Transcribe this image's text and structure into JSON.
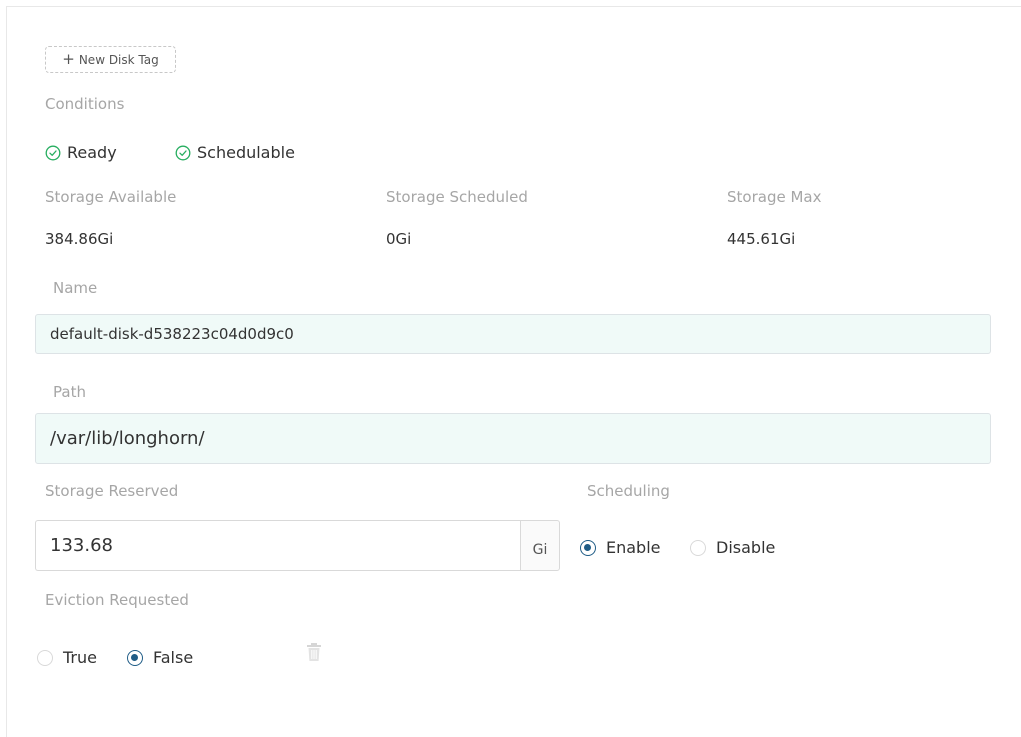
{
  "new_tag_button": {
    "label": "New Disk Tag",
    "icon": "plus-icon"
  },
  "conditions": {
    "label": "Conditions",
    "items": [
      {
        "label": "Ready",
        "icon": "check-circle-icon"
      },
      {
        "label": "Schedulable",
        "icon": "check-circle-icon"
      }
    ],
    "ok_color": "#27ae60"
  },
  "storage": {
    "available": {
      "label": "Storage Available",
      "value": "384.86Gi"
    },
    "scheduled": {
      "label": "Storage Scheduled",
      "value": "0Gi"
    },
    "max": {
      "label": "Storage Max",
      "value": "445.61Gi"
    }
  },
  "name_field": {
    "label": "Name",
    "value": "default-disk-d538223c04d0d9c0"
  },
  "path_field": {
    "label": "Path",
    "value": "/var/lib/longhorn/"
  },
  "storage_reserved": {
    "label": "Storage Reserved",
    "value": "133.68",
    "unit": "Gi"
  },
  "scheduling": {
    "label": "Scheduling",
    "options": [
      {
        "label": "Enable",
        "selected": true
      },
      {
        "label": "Disable",
        "selected": false
      }
    ]
  },
  "eviction": {
    "label": "Eviction Requested",
    "options": [
      {
        "label": "True",
        "selected": false
      },
      {
        "label": "False",
        "selected": true
      }
    ]
  },
  "delete_icon": "trash-icon",
  "colors": {
    "accent": "#1f5c86",
    "input_bg": "#f0faf8",
    "label": "#a6a6a6"
  }
}
